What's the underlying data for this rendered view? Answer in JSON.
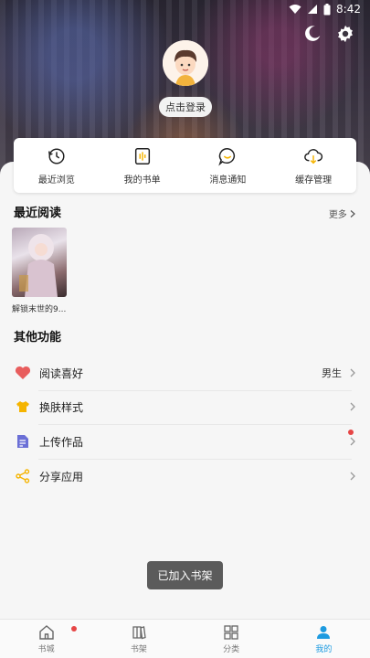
{
  "status_bar": {
    "time": "8:42"
  },
  "header": {
    "login_label": "点击登录"
  },
  "quick_actions": [
    {
      "label": "最近浏览",
      "icon": "history-icon"
    },
    {
      "label": "我的书单",
      "icon": "booklist-icon"
    },
    {
      "label": "消息通知",
      "icon": "message-icon"
    },
    {
      "label": "缓存管理",
      "icon": "cloud-download-icon"
    }
  ],
  "recent": {
    "title": "最近阅读",
    "more_label": "更多",
    "books": [
      {
        "title": "解锁末世的9..."
      }
    ]
  },
  "other": {
    "title": "其他功能",
    "items": [
      {
        "label": "阅读喜好",
        "value": "男生",
        "icon": "heart-icon",
        "color": "#e85d5d"
      },
      {
        "label": "换肤样式",
        "value": "",
        "icon": "shirt-icon",
        "color": "#f5b400"
      },
      {
        "label": "上传作品",
        "value": "",
        "icon": "upload-doc-icon",
        "color": "#6b6fd6"
      },
      {
        "label": "分享应用",
        "value": "",
        "icon": "share-icon",
        "color": "#f5b400"
      }
    ]
  },
  "toast": "已加入书架",
  "tabs": [
    {
      "label": "书城",
      "icon": "home-icon",
      "active": false
    },
    {
      "label": "书架",
      "icon": "bookshelf-icon",
      "active": false
    },
    {
      "label": "分类",
      "icon": "category-icon",
      "active": false
    },
    {
      "label": "我的",
      "icon": "profile-icon",
      "active": true
    }
  ],
  "colors": {
    "accent": "#1e9be0",
    "badge": "#e64545"
  }
}
